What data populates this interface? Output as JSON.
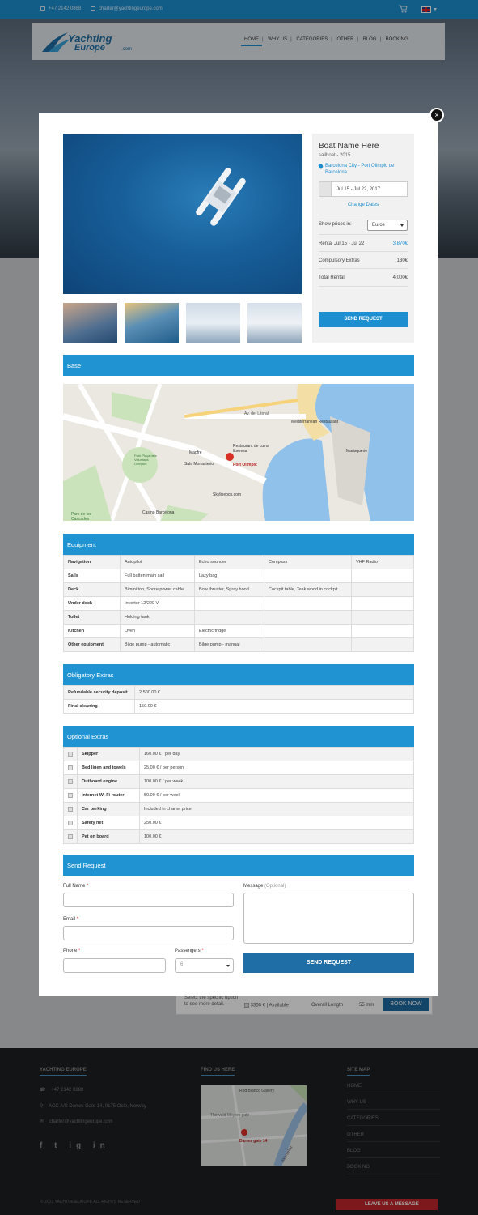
{
  "topbar": {
    "phone": "+47 2142 0888",
    "email": "charter@yachtingeurope.com"
  },
  "logo": {
    "line1": "Yachting",
    "line2": "Europe",
    ".com": ".com",
    "suffix": ".com"
  },
  "nav": [
    "HOME",
    "WHY US",
    "CATEGORIES",
    "OTHER",
    "BLOG",
    "BOOKING"
  ],
  "boat": {
    "name": "Boat Name Here",
    "subtitle": "sailboat - 2015",
    "location": "Barcelona City - Port Olimpic de Barcelona",
    "dates": "Jul 15 - Jul 22, 2017",
    "change_dates": "Change Dates",
    "show_prices_label": "Show prices in:",
    "currency": "Euros",
    "rental_label": "Rental Jul 15 - Jul 22",
    "rental_value": "3.870€",
    "extras_label": "Compulsory Extras",
    "extras_value": "130€",
    "total_label": "Total Rental",
    "total_value": "4,000€",
    "send_request": "SEND REQUEST"
  },
  "sections": {
    "base": "Base",
    "equipment": "Equipment",
    "obligatory": "Obligatory Extras",
    "optional": "Optional Extras",
    "send_request": "Send Request"
  },
  "map_labels": {
    "restaurant1": "Restaurant de cuina liberesa",
    "port": "Port Olimpic",
    "mediterranean": "Mediterranean Restaurant",
    "masquerie": "Marisquerie",
    "mapfre": "Mapfre",
    "sala": "Sala Monasterio",
    "casino": "Casino Barcelona",
    "skyline": "Skylinebcn.com",
    "parc": "Parc de les Cascades",
    "park": "Park Plaça dels Voluntaris Olímpics",
    "avlitoral": "Av. del Litoral"
  },
  "equipment": [
    [
      "Navigation",
      "Autopilot",
      "Echo sounder",
      "Compass",
      "VHF Radio"
    ],
    [
      "Sails",
      "Full batten main sail",
      "Lazy bag",
      "",
      ""
    ],
    [
      "Deck",
      "Bimini top, Shore power cable",
      "Bow thruster, Spray hood",
      "Cockpit table, Teak wood in cockpit",
      ""
    ],
    [
      "Under deck",
      "Inverter 12/220 V",
      "",
      "",
      ""
    ],
    [
      "Toilet",
      "Holding tank",
      "",
      "",
      ""
    ],
    [
      "Kitchen",
      "Oven",
      "Electric fridge",
      "",
      ""
    ],
    [
      "Other equipment",
      "Bilge pump - automatic",
      "Bilge pump - manual",
      "",
      ""
    ]
  ],
  "obligatory": [
    [
      "Refundable security deposit",
      "2,500.00 €"
    ],
    [
      "Final cleaning",
      "150.00 €"
    ]
  ],
  "optional": [
    [
      "Skipper",
      "160.00 € / per day"
    ],
    [
      "Bed linen and towels",
      "25.00 € / per person"
    ],
    [
      "Outboard engine",
      "100.00 € / per week"
    ],
    [
      "Internet Wi-Fi router",
      "50.00 € / per week"
    ],
    [
      "Car parking",
      "Included in charter price"
    ],
    [
      "Safety net",
      "250.00 €"
    ],
    [
      "Pet on board",
      "100.00 €"
    ]
  ],
  "form": {
    "full_name": "Full Name",
    "email": "Email",
    "phone": "Phone",
    "passengers": "Passengers",
    "passengers_value": "6",
    "message": "Message",
    "optional": "(Optional)",
    "required": "*",
    "submit": "SEND REQUEST"
  },
  "behind": {
    "text1": "Select the specific option",
    "text2": "to see more detail.",
    "price": "3350 €",
    "avail": "Available",
    "length_label": "Overall Length",
    "length_value": "55 mm",
    "book": "BOOK NOW"
  },
  "footer": {
    "col1": "YACHTING EUROPE",
    "col2": "FIND US HERE",
    "col3": "SITE MAP",
    "phone": "+47 2142 0888",
    "address": "ACC A/S Darres Gate 14, 0175 Oslo, Norway",
    "email": "charter@yachtingeurope.com",
    "sitemap": [
      "HOME",
      "WHY US",
      "CATEGORIES",
      "OTHER",
      "BLOG",
      "BOOKING"
    ],
    "copyright": "© 2017 YACHTINGEUROPE ALL RIGHTS RESERVED",
    "leave": "LEAVE US A MESSAGE",
    "map_pin": "Darres gate 14",
    "map_place": "Rod Bianco Gallery",
    "map_street": "Thorvald Meyers gate",
    "map_river": "Akerselva",
    "social": "f t ig in"
  }
}
